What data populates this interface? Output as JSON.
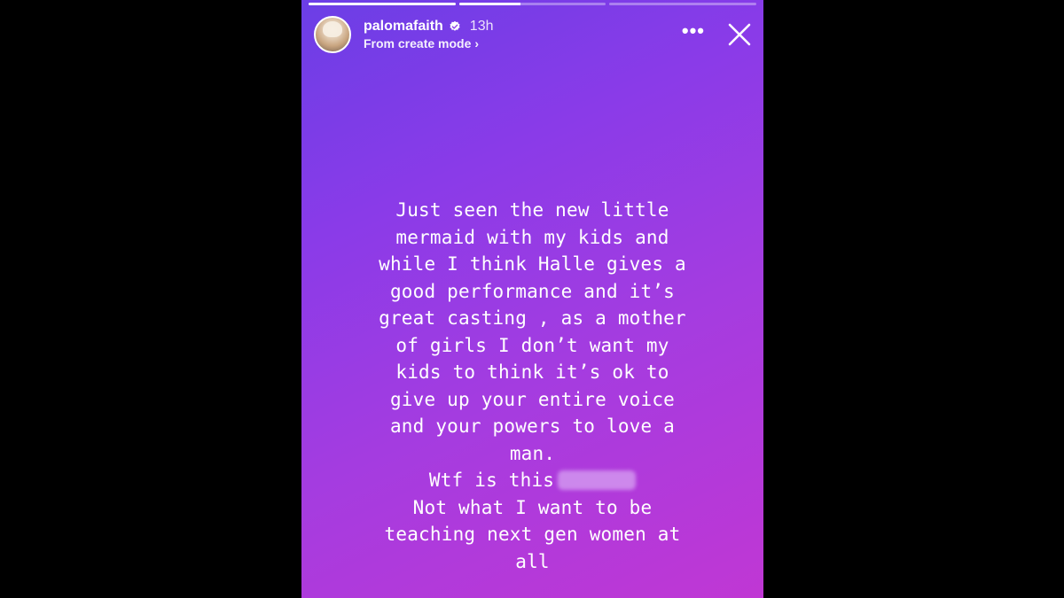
{
  "story": {
    "progress": [
      {
        "fill_fraction": 1.0
      },
      {
        "fill_fraction": 0.42
      },
      {
        "fill_fraction": 0.0
      }
    ],
    "username": "palomafaith",
    "time": "13h",
    "subtitle": "From create mode",
    "subtitle_chevron": "›",
    "more_label": "•••",
    "close_icon": "close-icon",
    "verified_icon": "verified-badge-icon",
    "colors": {
      "gradient_top": "#6b3ee6",
      "gradient_bottom": "#c037d4",
      "text": "#ffffff"
    },
    "lines": [
      "Just seen the new little",
      "mermaid with my kids and",
      "while I think Halle gives a",
      "good performance and it’s",
      "great casting , as a mother",
      "of girls I don’t want my",
      "kids to think it’s ok to",
      "give up your entire voice",
      "and your powers to love a",
      "man.",
      "Wtf is this",
      "Not what I want to be",
      "teaching next gen women at",
      "all"
    ]
  }
}
